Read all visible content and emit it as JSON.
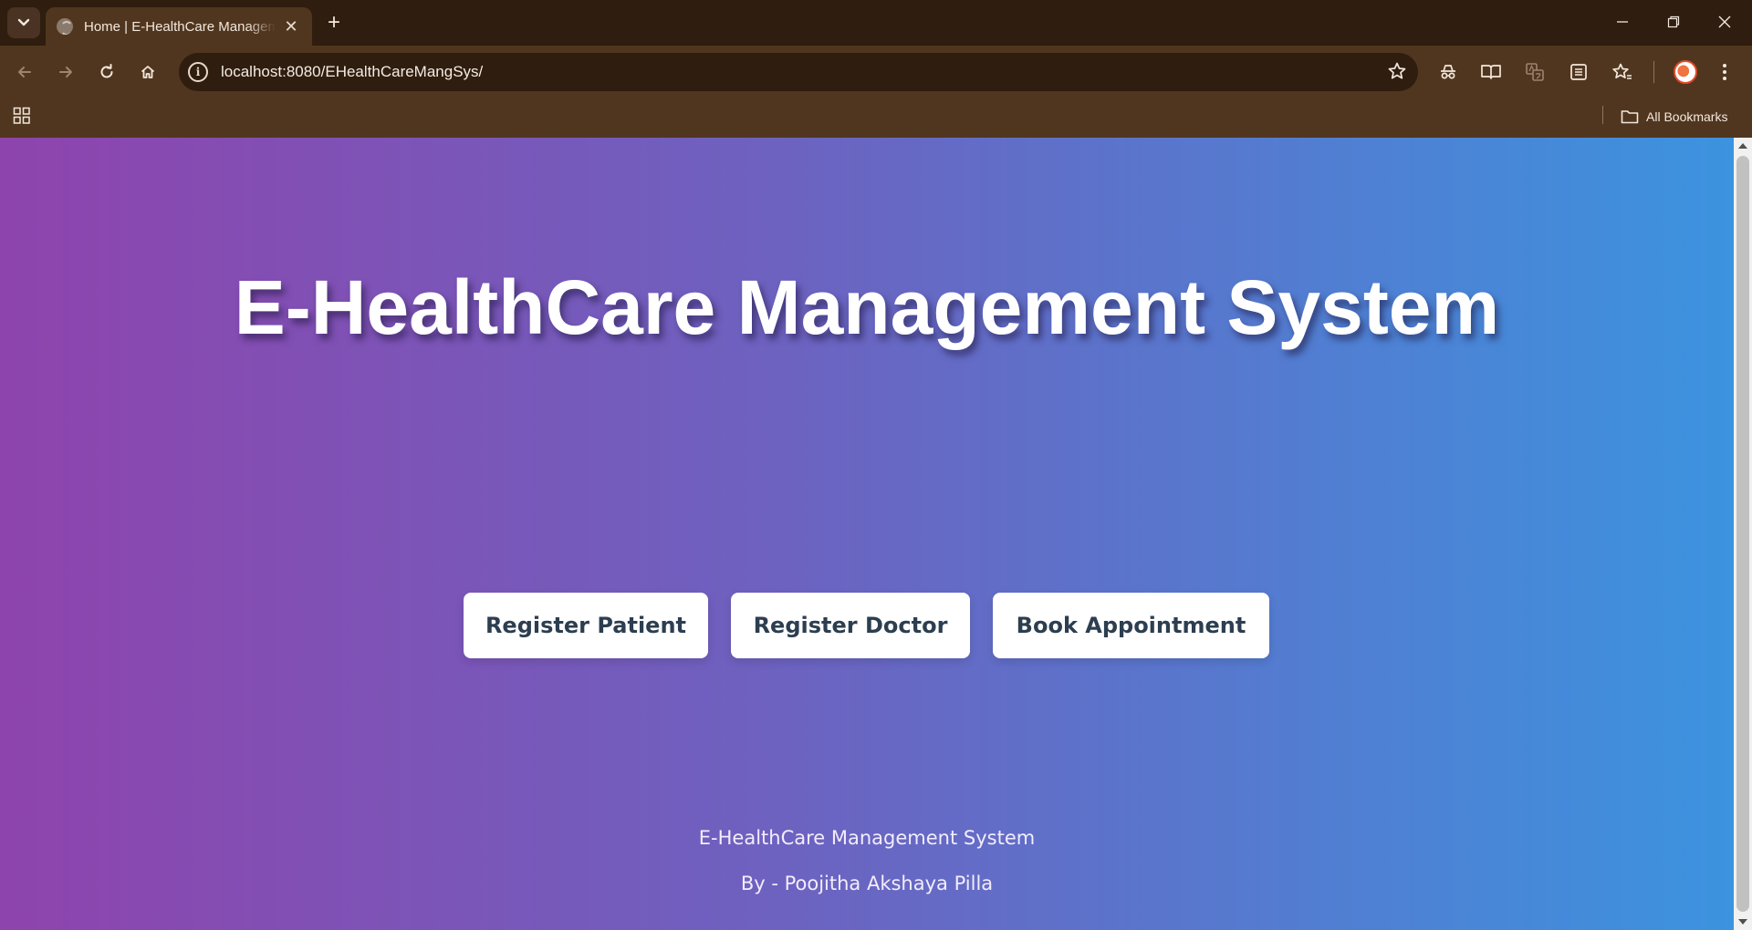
{
  "browser": {
    "tab": {
      "title": "Home | E-HealthCare Management System",
      "favicon": "globe-icon",
      "close_glyph": "✕"
    },
    "new_tab_glyph": "+",
    "address_bar": {
      "url": "localhost:8080/EHealthCareMangSys/",
      "info_icon": "info-icon",
      "info_glyph": "i"
    },
    "bookmarks_bar": {
      "all_bookmarks_label": "All Bookmarks"
    },
    "colors": {
      "chrome_dark": "#2f1d0f",
      "chrome_mid": "#51361f"
    }
  },
  "page": {
    "title": "E-HealthCare Management System",
    "buttons": [
      {
        "label": "Register Patient"
      },
      {
        "label": "Register Doctor"
      },
      {
        "label": "Book Appointment"
      }
    ],
    "footer": {
      "title": "E-HealthCare Management System",
      "author": "By - Poojitha Akshaya Pilla"
    },
    "colors": {
      "gradient_start": "#8e44ad",
      "gradient_end": "#3c93df",
      "button_bg": "#ffffff",
      "button_text": "#2c3e50"
    }
  }
}
